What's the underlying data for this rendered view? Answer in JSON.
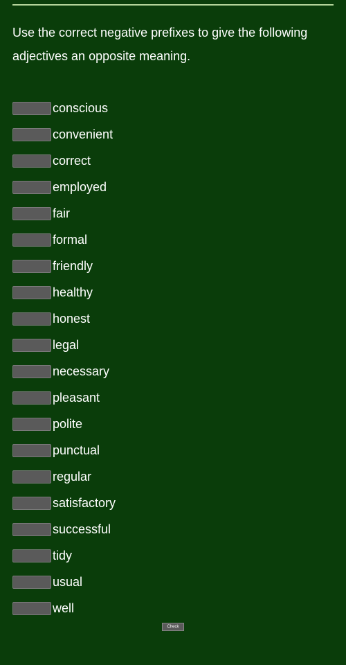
{
  "instruction": "Use the correct negative prefixes to give the following adjectives an opposite meaning.",
  "adjectives": [
    "conscious",
    "convenient",
    "correct",
    "employed",
    "fair",
    "formal",
    "friendly",
    "healthy",
    "honest",
    "legal",
    "necessary",
    "pleasant",
    "polite",
    "punctual",
    "regular",
    "satisfactory",
    "successful",
    "tidy",
    "usual",
    "well"
  ],
  "submit_label": "Check"
}
